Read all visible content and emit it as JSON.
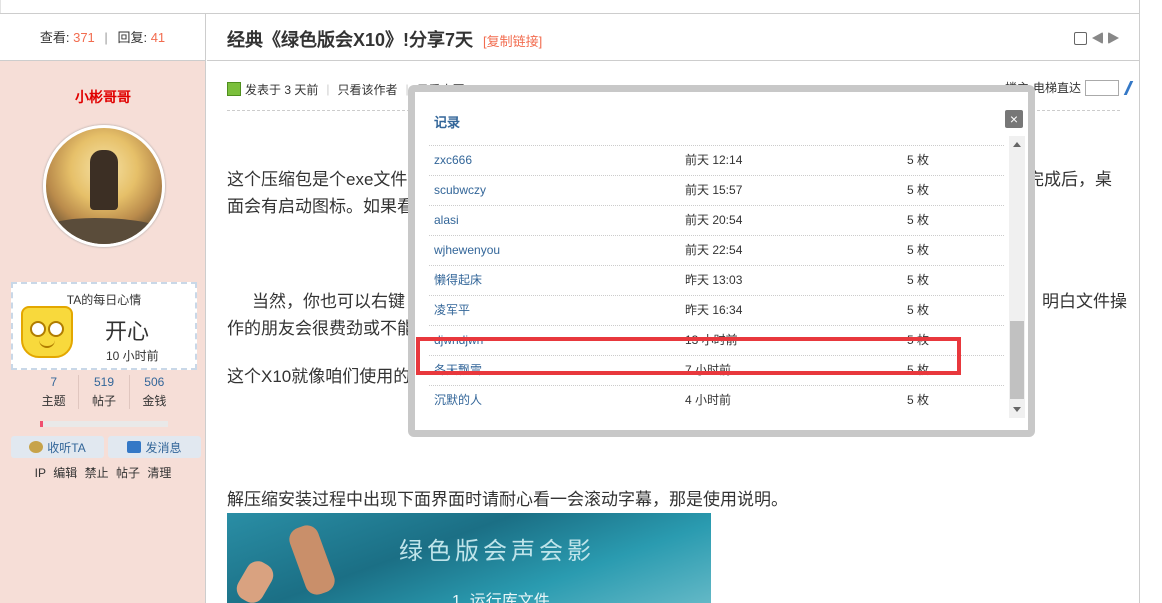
{
  "thread": {
    "views_label": "查看:",
    "views": "371",
    "replies_label": "回复:",
    "replies": "41",
    "title": "经典《绿色版会X10》!分享7天",
    "copy_link": "[复制链接]"
  },
  "author": {
    "name": "小彬哥哥",
    "mood_title": "TA的每日心情",
    "mood": "开心",
    "mood_time": "10 小时前",
    "stats": [
      {
        "value": "7",
        "label": "主题"
      },
      {
        "value": "519",
        "label": "帖子"
      },
      {
        "value": "506",
        "label": "金钱"
      }
    ],
    "progress_fraction": 0.02,
    "follow_label": "收听TA",
    "message_label": "发消息",
    "admin_links": [
      "IP",
      "编辑",
      "禁止",
      "帖子",
      "清理"
    ]
  },
  "post": {
    "posted": "发表于 3 天前",
    "only_author": "只看该作者",
    "only_big_image": "只看大图",
    "floor_label": "楼主",
    "elevator_label": "电梯直达",
    "p1_left": "这个压缩包是个exe文件",
    "p1_right": "完成后，桌",
    "p1_line2": "面会有启动图标。如果看",
    "p2_left": "当然，你也可以右键",
    "p2_right": "明白文件操",
    "p2_line2": "作的朋友会很费劲或不能",
    "p3": "这个X10就像咱们使用的",
    "p4": "解压缩安装过程中出现下面界面时请耐心看一会滚动字幕，那是使用说明。",
    "image_title": "绿色版会声会影",
    "image_sub": "1. 运行库文件"
  },
  "modal": {
    "title": "记录",
    "close": "×",
    "rows": [
      {
        "user": "zxc666",
        "time": "前天 12:14",
        "amount": "5 枚"
      },
      {
        "user": "scubwczy",
        "time": "前天 15:57",
        "amount": "5 枚"
      },
      {
        "user": "alasi",
        "time": "前天 20:54",
        "amount": "5 枚"
      },
      {
        "user": "wjhewenyou",
        "time": "前天 22:54",
        "amount": "5 枚"
      },
      {
        "user": "懒得起床",
        "time": "昨天 13:03",
        "amount": "5 枚"
      },
      {
        "user": "凌军平",
        "time": "昨天 16:34",
        "amount": "5 枚"
      },
      {
        "user": "djwndjwn",
        "time": "13 小时前",
        "amount": "5 枚"
      },
      {
        "user": "冬天飘雪",
        "time": "7 小时前",
        "amount": "5 枚"
      },
      {
        "user": "沉默的人",
        "time": "4 小时前",
        "amount": "5 枚"
      }
    ]
  }
}
